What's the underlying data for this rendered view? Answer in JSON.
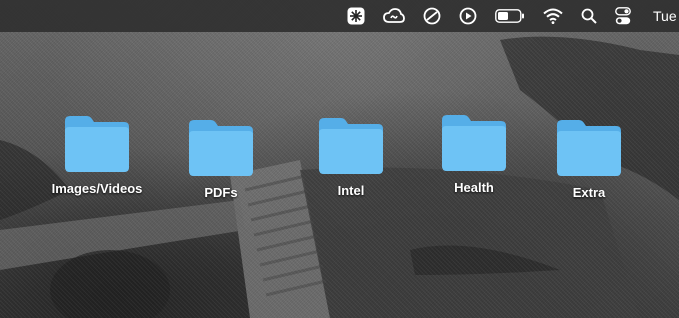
{
  "menubar": {
    "clock_text": "Tue",
    "status_icons": [
      {
        "name": "app-status-icon"
      },
      {
        "name": "creative-cloud-icon"
      },
      {
        "name": "circle-slash-icon"
      },
      {
        "name": "play-circle-icon"
      },
      {
        "name": "battery-icon"
      },
      {
        "name": "wifi-icon"
      },
      {
        "name": "spotlight-search-icon"
      },
      {
        "name": "control-center-icon"
      }
    ]
  },
  "desktop": {
    "folders": [
      {
        "label": "Images/Videos",
        "icon": "folder-icon"
      },
      {
        "label": "PDFs",
        "icon": "folder-icon"
      },
      {
        "label": "Intel",
        "icon": "folder-icon"
      },
      {
        "label": "Health",
        "icon": "folder-icon"
      },
      {
        "label": "Extra",
        "icon": "folder-icon"
      }
    ]
  },
  "colors": {
    "folder_body": "#6ec3f5",
    "folder_tab": "#55aee8",
    "menubar_bg": "#303030"
  }
}
